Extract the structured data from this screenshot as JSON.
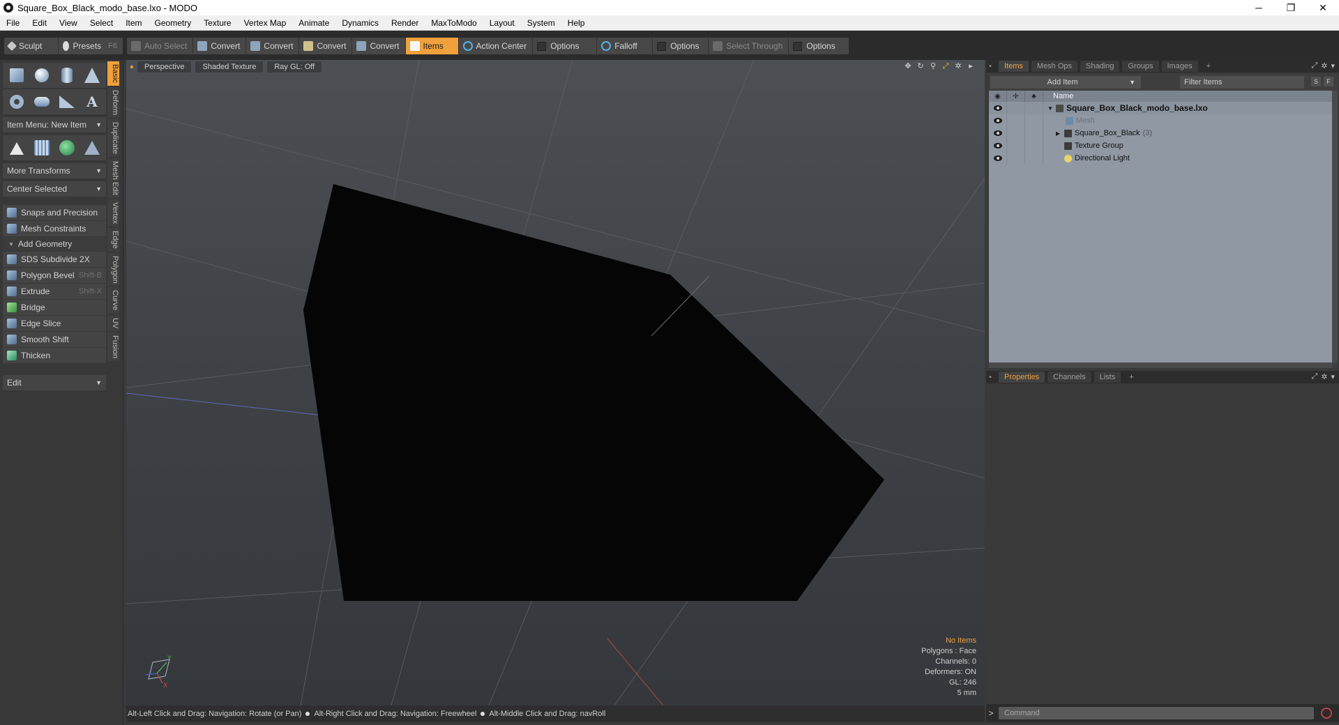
{
  "window": {
    "title": "Square_Box_Black_modo_base.lxo - MODO",
    "minimize": "─",
    "maximize": "❐",
    "close": "✕"
  },
  "menu": [
    "File",
    "Edit",
    "View",
    "Select",
    "Item",
    "Geometry",
    "Texture",
    "Vertex Map",
    "Animate",
    "Dynamics",
    "Render",
    "MaxToModo",
    "Layout",
    "System",
    "Help"
  ],
  "toolbar": {
    "sculpt": "Sculpt",
    "presets": "Presets",
    "presets_key": "F6",
    "auto_select": "Auto Select",
    "convert1": "Convert",
    "convert2": "Convert",
    "convert3": "Convert",
    "convert4": "Convert",
    "items": "Items",
    "action_center": "Action Center",
    "options1": "Options",
    "falloff": "Falloff",
    "options2": "Options",
    "select_through": "Select Through",
    "options3": "Options"
  },
  "left": {
    "item_menu": "Item Menu: New Item",
    "more_transforms": "More Transforms",
    "center_selected": "Center Selected",
    "snaps": "Snaps and Precision",
    "mesh_constraints": "Mesh Constraints",
    "add_geometry": "Add Geometry",
    "tools": [
      {
        "label": "SDS Subdivide 2X",
        "key": ""
      },
      {
        "label": "Polygon Bevel",
        "key": "Shift-B"
      },
      {
        "label": "Extrude",
        "key": "Shift-X"
      },
      {
        "label": "Bridge",
        "key": ""
      },
      {
        "label": "Edge Slice",
        "key": ""
      },
      {
        "label": "Smooth Shift",
        "key": ""
      },
      {
        "label": "Thicken",
        "key": ""
      }
    ],
    "edit": "Edit",
    "vtabs": [
      "Basic",
      "Deform",
      "Duplicate",
      "Mesh Edit",
      "Vertex",
      "Edge",
      "Polygon",
      "Curve",
      "UV",
      "Fusion"
    ]
  },
  "viewport": {
    "perspective": "Perspective",
    "shading": "Shaded Texture",
    "raygl": "Ray GL: Off",
    "info": {
      "no_items": "No Items",
      "polygons": "Polygons : Face",
      "channels": "Channels: 0",
      "deformers": "Deformers: ON",
      "gl": "GL: 246",
      "scale": "5 mm"
    },
    "axis_y": "Y",
    "axis_x": "X"
  },
  "status": {
    "hint1": "Alt-Left Click and Drag: Navigation: Rotate (or Pan)",
    "hint2": "Alt-Right Click and Drag: Navigation: Freewheel",
    "hint3": "Alt-Middle Click and Drag: navRoll"
  },
  "items_panel": {
    "tabs": [
      "Items",
      "Mesh Ops",
      "Shading",
      "Groups",
      "Images"
    ],
    "plus": "+",
    "add_item": "Add Item",
    "filter": "Filter Items",
    "btn_s": "S",
    "btn_f": "F",
    "col_name": "Name",
    "tree": [
      {
        "label": "Square_Box_Black_modo_base.lxo",
        "count": ""
      },
      {
        "label": "Mesh",
        "count": ""
      },
      {
        "label": "Square_Box_Black",
        "count": "(3)"
      },
      {
        "label": "Texture Group",
        "count": ""
      },
      {
        "label": "Directional Light",
        "count": ""
      }
    ]
  },
  "props_panel": {
    "tabs": [
      "Properties",
      "Channels",
      "Lists"
    ],
    "plus": "+"
  },
  "command": {
    "prompt": ">",
    "placeholder": "Command"
  }
}
